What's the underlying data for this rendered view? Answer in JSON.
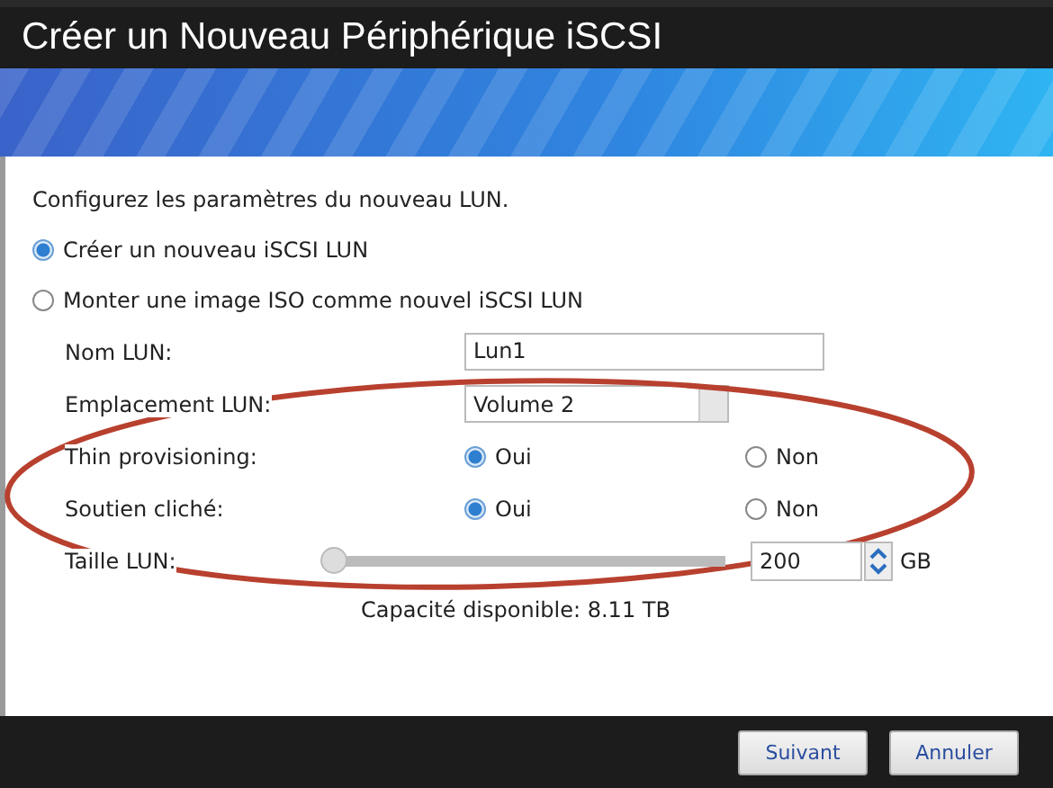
{
  "window": {
    "title": "Créer un Nouveau Périphérique iSCSI"
  },
  "intro": "Configurez les paramètres du nouveau LUN.",
  "modes": [
    {
      "label": "Créer un nouveau iSCSI LUN",
      "selected": true
    },
    {
      "label": "Monter une image ISO comme nouvel iSCSI LUN",
      "selected": false
    }
  ],
  "lun_name": {
    "label": "Nom LUN:",
    "value": "Lun1"
  },
  "lun_location": {
    "label": "Emplacement LUN:",
    "value": "Volume 2"
  },
  "choices": [
    {
      "label": "Thin provisioning:",
      "options": [
        {
          "label": "Oui",
          "selected": true
        },
        {
          "label": "Non",
          "selected": false
        }
      ]
    },
    {
      "label": "Soutien cliché:",
      "options": [
        {
          "label": "Oui",
          "selected": true
        },
        {
          "label": "Non",
          "selected": false
        }
      ]
    }
  ],
  "lun_size": {
    "label": "Taille LUN:",
    "level": 0,
    "value": "200",
    "unit": "GB"
  },
  "capacity": "Capacité disponible: 8.11 TB",
  "buttons": [
    {
      "label": "Suivant"
    },
    {
      "label": "Annuler"
    }
  ]
}
